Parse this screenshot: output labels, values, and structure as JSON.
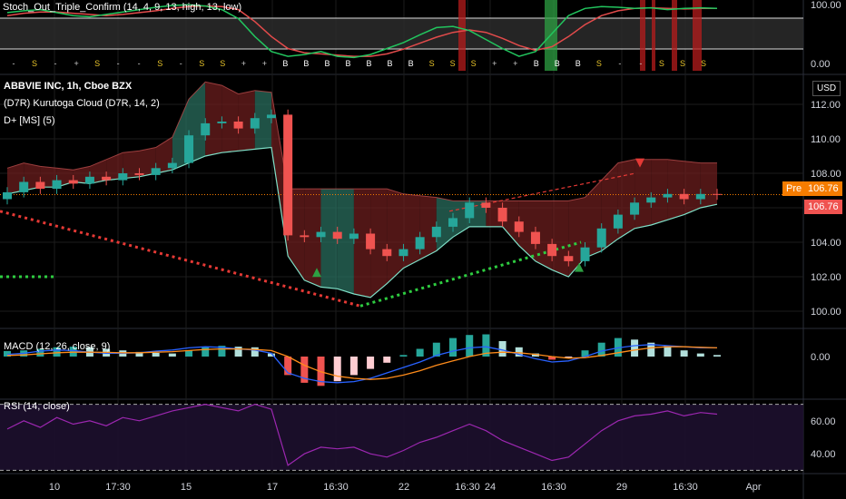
{
  "colors": {
    "background": "#000000",
    "grid": "#1c1c1c",
    "up": "#26a69a",
    "down": "#ef5350",
    "cloud_bull": "#2a6e5e",
    "cloud_bear": "#6b1e1e",
    "stoch_k": "#22c55e",
    "stoch_d": "#e34b4b",
    "macd": "#2962ff",
    "signal": "#ff8c1a",
    "rsi": "#9c27b0",
    "pre_tag": "#f57c00",
    "price_tag": "#ef5350"
  },
  "symbol_header": "ABBVIE INC, 1h, Cboe BZX",
  "indicators": {
    "stoch": "Stoch_Out_Triple_Confirm (14, 4, 9, 13, high, 13, low)",
    "kurutoga": "(D7R) Kurutoga Cloud (D7R, 14, 2)",
    "dplus": "D+ [MS] (5)",
    "macd": "MACD (12, 26, close, 9)",
    "rsi": "RSI (14, close)"
  },
  "currency": "USD",
  "pre_label": "Pre",
  "pre_price": "106.76",
  "last_price": "106.76",
  "main_axis": [
    "112.00",
    "110.00",
    "108.00",
    "106.00",
    "104.00",
    "102.00",
    "100.00"
  ],
  "stoch_axis": [
    "100.00",
    "0.00"
  ],
  "macd_axis": [
    "0.00"
  ],
  "rsi_axis": [
    "60.00",
    "40.00"
  ],
  "x_labels": [
    "10",
    "17:30",
    "15",
    "17",
    "16:30",
    "22",
    "16:30",
    "24",
    "16:30",
    "29",
    "16:30",
    "Apr"
  ],
  "signal_row": [
    "-",
    "S",
    "-",
    "+",
    "S",
    "-",
    "-",
    "S",
    "-",
    "S",
    "S",
    "+",
    "+",
    "B",
    "B",
    "B",
    "B",
    "B",
    "B",
    "B",
    "S",
    "S",
    "S",
    "+",
    "+",
    "B",
    "B",
    "B",
    "S",
    "-",
    "-",
    "S",
    "S",
    "S"
  ],
  "chart_data": [
    {
      "type": "line",
      "name": "Stoch_Out_Triple_Confirm",
      "ylim": [
        0,
        100
      ],
      "series": [
        {
          "name": "K",
          "values": [
            85,
            88,
            90,
            85,
            80,
            78,
            82,
            86,
            90,
            94,
            97,
            98,
            96,
            90,
            75,
            45,
            20,
            12,
            15,
            20,
            12,
            10,
            15,
            25,
            35,
            48,
            60,
            62,
            55,
            40,
            25,
            12,
            20,
            50,
            80,
            92,
            95,
            94,
            92,
            93,
            90,
            92,
            93,
            92
          ]
        },
        {
          "name": "D",
          "values": [
            80,
            84,
            86,
            86,
            84,
            82,
            80,
            82,
            85,
            88,
            92,
            95,
            96,
            95,
            90,
            70,
            45,
            25,
            18,
            16,
            14,
            12,
            12,
            16,
            24,
            34,
            44,
            52,
            56,
            52,
            42,
            30,
            22,
            28,
            45,
            65,
            80,
            88,
            92,
            93,
            92,
            91,
            92,
            92
          ]
        }
      ]
    },
    {
      "type": "candlestick",
      "name": "ABBVIE INC, 1h, Cboe BZX",
      "ylim": [
        99,
        113
      ],
      "series": [
        {
          "name": "close",
          "values": [
            106.9,
            107.5,
            107.1,
            107.6,
            107.4,
            107.8,
            107.6,
            108.0,
            107.9,
            108.3,
            108.6,
            110.2,
            110.9,
            111.0,
            110.6,
            111.2,
            111.4,
            104.4,
            104.3,
            104.6,
            104.2,
            104.5,
            103.6,
            103.2,
            103.6,
            104.3,
            104.9,
            105.4,
            106.3,
            106.0,
            105.2,
            104.6,
            103.9,
            103.2,
            102.9,
            103.7,
            104.8,
            105.6,
            106.3,
            106.6,
            106.8,
            106.5,
            106.8,
            106.76
          ]
        },
        {
          "name": "Kurutoga cloud upper",
          "values": [
            108.3,
            108.6,
            108.4,
            108.3,
            108.2,
            108.4,
            108.8,
            109.2,
            109.3,
            109.5,
            110.1,
            112.3,
            113.3,
            113.1,
            112.6,
            112.8,
            112.7,
            107.1,
            107.1,
            107.1,
            107.1,
            107.1,
            107.1,
            107.1,
            106.8,
            106.7,
            106.6,
            106.4,
            106.4,
            106.4,
            106.4,
            106.4,
            106.4,
            106.4,
            106.4,
            106.6,
            107.6,
            108.6,
            108.8,
            108.8,
            108.8,
            108.7,
            108.6,
            108.6
          ]
        },
        {
          "name": "Kurutoga cloud lower",
          "values": [
            106.8,
            107.0,
            107.2,
            107.2,
            107.5,
            107.4,
            107.6,
            107.7,
            107.8,
            108.0,
            108.2,
            108.6,
            109.0,
            109.2,
            109.3,
            109.4,
            109.5,
            103.2,
            101.8,
            101.4,
            101.3,
            101.0,
            100.8,
            101.6,
            102.5,
            103.0,
            103.5,
            104.3,
            104.9,
            104.9,
            104.9,
            103.8,
            102.9,
            102.4,
            102.0,
            103.1,
            103.5,
            104.2,
            104.8,
            105.0,
            105.3,
            105.6,
            106.0,
            106.2
          ]
        }
      ]
    },
    {
      "type": "bar",
      "name": "MACD",
      "series": [
        {
          "name": "histogram",
          "values": [
            0.18,
            0.2,
            0.25,
            0.3,
            0.32,
            0.3,
            0.25,
            0.2,
            0.15,
            0.12,
            0.1,
            0.2,
            0.3,
            0.35,
            0.32,
            0.3,
            0.1,
            -0.6,
            -0.85,
            -0.95,
            -0.8,
            -0.6,
            -0.4,
            -0.2,
            0.05,
            0.25,
            0.45,
            0.6,
            0.7,
            0.72,
            0.5,
            0.3,
            0.1,
            -0.1,
            -0.05,
            0.2,
            0.45,
            0.6,
            0.55,
            0.45,
            0.35,
            0.2,
            0.1,
            0.05
          ]
        },
        {
          "name": "MACD",
          "values": [
            0.2,
            0.3,
            0.5,
            0.6,
            0.55,
            0.4,
            0.3,
            0.3,
            0.35,
            0.5,
            0.6,
            0.8,
            0.9,
            0.85,
            0.7,
            0.6,
            0.3,
            -1.5,
            -2.0,
            -2.3,
            -2.4,
            -2.3,
            -2.0,
            -1.5,
            -1.0,
            -0.5,
            0.1,
            0.5,
            0.8,
            0.9,
            0.6,
            0.2,
            -0.2,
            -0.5,
            -0.4,
            0.0,
            0.5,
            0.8,
            1.0,
            1.1,
            1.0,
            0.9,
            0.8,
            0.8
          ]
        },
        {
          "name": "signal",
          "values": [
            0.1,
            0.15,
            0.25,
            0.35,
            0.4,
            0.4,
            0.38,
            0.35,
            0.35,
            0.4,
            0.45,
            0.55,
            0.65,
            0.7,
            0.7,
            0.65,
            0.55,
            0.0,
            -0.8,
            -1.4,
            -1.8,
            -2.0,
            -2.1,
            -2.0,
            -1.7,
            -1.3,
            -0.8,
            -0.4,
            0.0,
            0.3,
            0.4,
            0.35,
            0.2,
            0.0,
            -0.15,
            -0.1,
            0.1,
            0.35,
            0.6,
            0.8,
            0.9,
            0.9,
            0.85,
            0.8
          ]
        }
      ]
    },
    {
      "type": "line",
      "name": "RSI (14, close)",
      "ylim": [
        28,
        72
      ],
      "series": [
        {
          "name": "RSI",
          "values": [
            55,
            60,
            56,
            62,
            58,
            60,
            57,
            62,
            60,
            63,
            66,
            68,
            70,
            68,
            66,
            70,
            67,
            33,
            40,
            44,
            43,
            44,
            40,
            38,
            42,
            47,
            50,
            54,
            58,
            54,
            48,
            44,
            40,
            36,
            38,
            46,
            54,
            60,
            63,
            64,
            66,
            63,
            65,
            64
          ]
        }
      ]
    }
  ]
}
